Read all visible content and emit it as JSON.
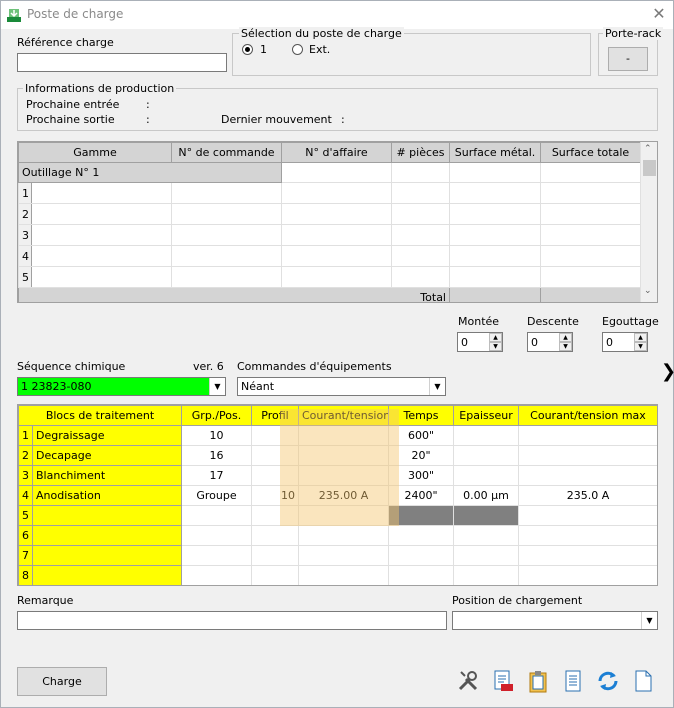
{
  "window": {
    "title": "Poste de charge",
    "close_glyph": "✕"
  },
  "reference": {
    "label": "Référence charge",
    "value": ""
  },
  "selection": {
    "title": "Sélection du poste de charge",
    "options": [
      "1",
      "Ext."
    ],
    "selected": "1"
  },
  "porte_rack": {
    "title": "Porte-rack",
    "button_label": "-"
  },
  "production": {
    "title": "Informations de production",
    "prochaine_entree_label": "Prochaine entrée",
    "prochaine_entree_value": ":",
    "prochaine_sortie_label": "Prochaine sortie",
    "prochaine_sortie_value": ":",
    "dernier_mouvement_label": "Dernier mouvement",
    "dernier_mouvement_value": ":"
  },
  "grid1": {
    "headers": [
      "Gamme",
      "N° de commande",
      "N° d'affaire",
      "# pièces",
      "Surface métal.",
      "Surface totale"
    ],
    "group_label": "Outillage N° 1",
    "rows": [
      "1",
      "2",
      "3",
      "4",
      "5"
    ],
    "total_label": "Total"
  },
  "timings": {
    "montee_label": "Montée",
    "montee_value": "0",
    "descente_label": "Descente",
    "descente_value": "0",
    "egouttage_label": "Egouttage",
    "egouttage_value": "0"
  },
  "sequence": {
    "label": "Séquence chimique",
    "version": "ver. 6",
    "value": "1 23823-080",
    "color": "#00ff00"
  },
  "commandes": {
    "label": "Commandes d'équipements",
    "value": "Néant"
  },
  "expand_glyph": "❯",
  "grid2": {
    "headers": [
      "Blocs de traitement",
      "Grp./Pos.",
      "Profil",
      "Courant/tension",
      "Temps",
      "Epaisseur",
      "Courant/tension max"
    ],
    "rows": [
      {
        "n": "1",
        "name": "Degraissage",
        "grp": "10",
        "profil": "",
        "courant": "",
        "temps": "600\"",
        "epaisseur": "",
        "max": ""
      },
      {
        "n": "2",
        "name": "Decapage",
        "grp": "16",
        "profil": "",
        "courant": "",
        "temps": "20\"",
        "epaisseur": "",
        "max": ""
      },
      {
        "n": "3",
        "name": "Blanchiment",
        "grp": "17",
        "profil": "",
        "courant": "",
        "temps": "300\"",
        "epaisseur": "",
        "max": ""
      },
      {
        "n": "4",
        "name": "Anodisation",
        "grp": "Groupe",
        "profil": "10",
        "courant": "235.00 A",
        "temps": "2400\"",
        "epaisseur": "0.00 µm",
        "max": "235.0 A"
      },
      {
        "n": "5",
        "name": "",
        "grp": "",
        "profil": "",
        "courant": "",
        "temps": "",
        "epaisseur": "",
        "max": ""
      },
      {
        "n": "6",
        "name": "",
        "grp": "",
        "profil": "",
        "courant": "",
        "temps": "",
        "epaisseur": "",
        "max": ""
      },
      {
        "n": "7",
        "name": "",
        "grp": "",
        "profil": "",
        "courant": "",
        "temps": "",
        "epaisseur": "",
        "max": ""
      },
      {
        "n": "8",
        "name": "",
        "grp": "",
        "profil": "",
        "courant": "",
        "temps": "",
        "epaisseur": "",
        "max": ""
      }
    ],
    "highlight_color": "#f5c56f"
  },
  "remarque": {
    "label": "Remarque",
    "value": ""
  },
  "position": {
    "label": "Position de chargement",
    "value": ""
  },
  "charge_button": "Charge",
  "toolbar_icons": [
    "tools-icon",
    "report-icon",
    "clipboard-icon",
    "document-list-icon",
    "refresh-icon",
    "blank-page-icon"
  ]
}
